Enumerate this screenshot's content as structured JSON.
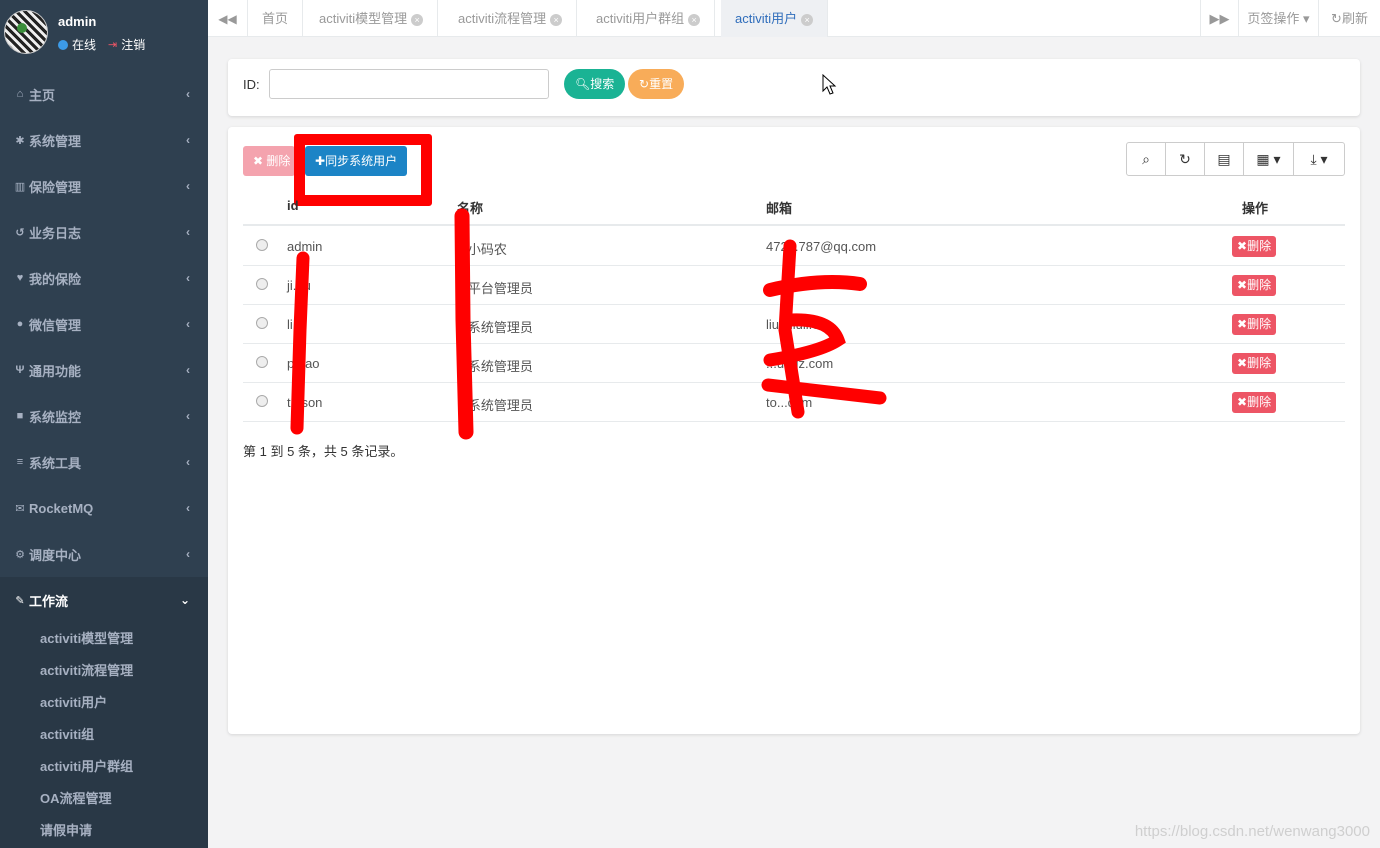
{
  "user": {
    "name": "admin",
    "status": "在线",
    "logout": "注销"
  },
  "nav": [
    {
      "label": "主页",
      "icon": "home-icon",
      "glyph": "⌂"
    },
    {
      "label": "系统管理",
      "icon": "gear-icon",
      "glyph": "✱"
    },
    {
      "label": "保险管理",
      "icon": "bank-icon",
      "glyph": "▥"
    },
    {
      "label": "业务日志",
      "icon": "history-icon",
      "glyph": "↺"
    },
    {
      "label": "我的保险",
      "icon": "heart-icon",
      "glyph": "♥"
    },
    {
      "label": "微信管理",
      "icon": "comment-icon",
      "glyph": "●"
    },
    {
      "label": "通用功能",
      "icon": "cutlery-icon",
      "glyph": "Ψ"
    },
    {
      "label": "系统监控",
      "icon": "video-icon",
      "glyph": "■"
    },
    {
      "label": "系统工具",
      "icon": "bars-icon",
      "glyph": "≡"
    },
    {
      "label": "RocketMQ",
      "icon": "envelope-icon",
      "glyph": "✉"
    },
    {
      "label": "调度中心",
      "icon": "cogs-icon",
      "glyph": "⚙"
    },
    {
      "label": "工作流",
      "icon": "wrench-icon",
      "glyph": "✎"
    }
  ],
  "subnav": [
    "activiti模型管理",
    "activiti流程管理",
    "activiti用户",
    "activiti组",
    "activiti用户群组",
    "OA流程管理",
    "请假申请"
  ],
  "tabs": [
    "首页",
    "activiti模型管理",
    "activiti流程管理",
    "activiti用户群组",
    "activiti用户"
  ],
  "tab_actions": {
    "tab_ops": "页签操作",
    "refresh": "刷新"
  },
  "search": {
    "id_label": "ID:",
    "search_btn": "搜索",
    "reset_btn": "重置"
  },
  "table_toolbar": {
    "delete_btn": "删除",
    "sync_btn": "同步系统用户"
  },
  "table": {
    "headers": [
      "id",
      "名称",
      "邮箱",
      "操作"
    ],
    "rows": [
      {
        "id": "admin",
        "name": "...小码农",
        "email": "472...787@qq.com",
        "action": "删除"
      },
      {
        "id": "ji...u",
        "name": "...平台管理员",
        "email": "",
        "action": "删除"
      },
      {
        "id": "li...",
        "name": "...系统管理员",
        "email": "liu...liuli.c...",
        "action": "删除"
      },
      {
        "id": "p...ao",
        "name": "...系统管理员",
        "email": "...uogz.com",
        "action": "删除"
      },
      {
        "id": "t...son",
        "name": "...系统管理员",
        "email": "to...com",
        "action": "删除"
      }
    ]
  },
  "pager": "第 1 到 5 条，共 5 条记录。",
  "watermark": "https://blog.csdn.net/wenwang3000",
  "colors": {
    "sidebar": "#2f4050",
    "primary": "#1c84c6",
    "success": "#1ab394",
    "warning": "#f8ac59",
    "danger": "#ed5565"
  }
}
